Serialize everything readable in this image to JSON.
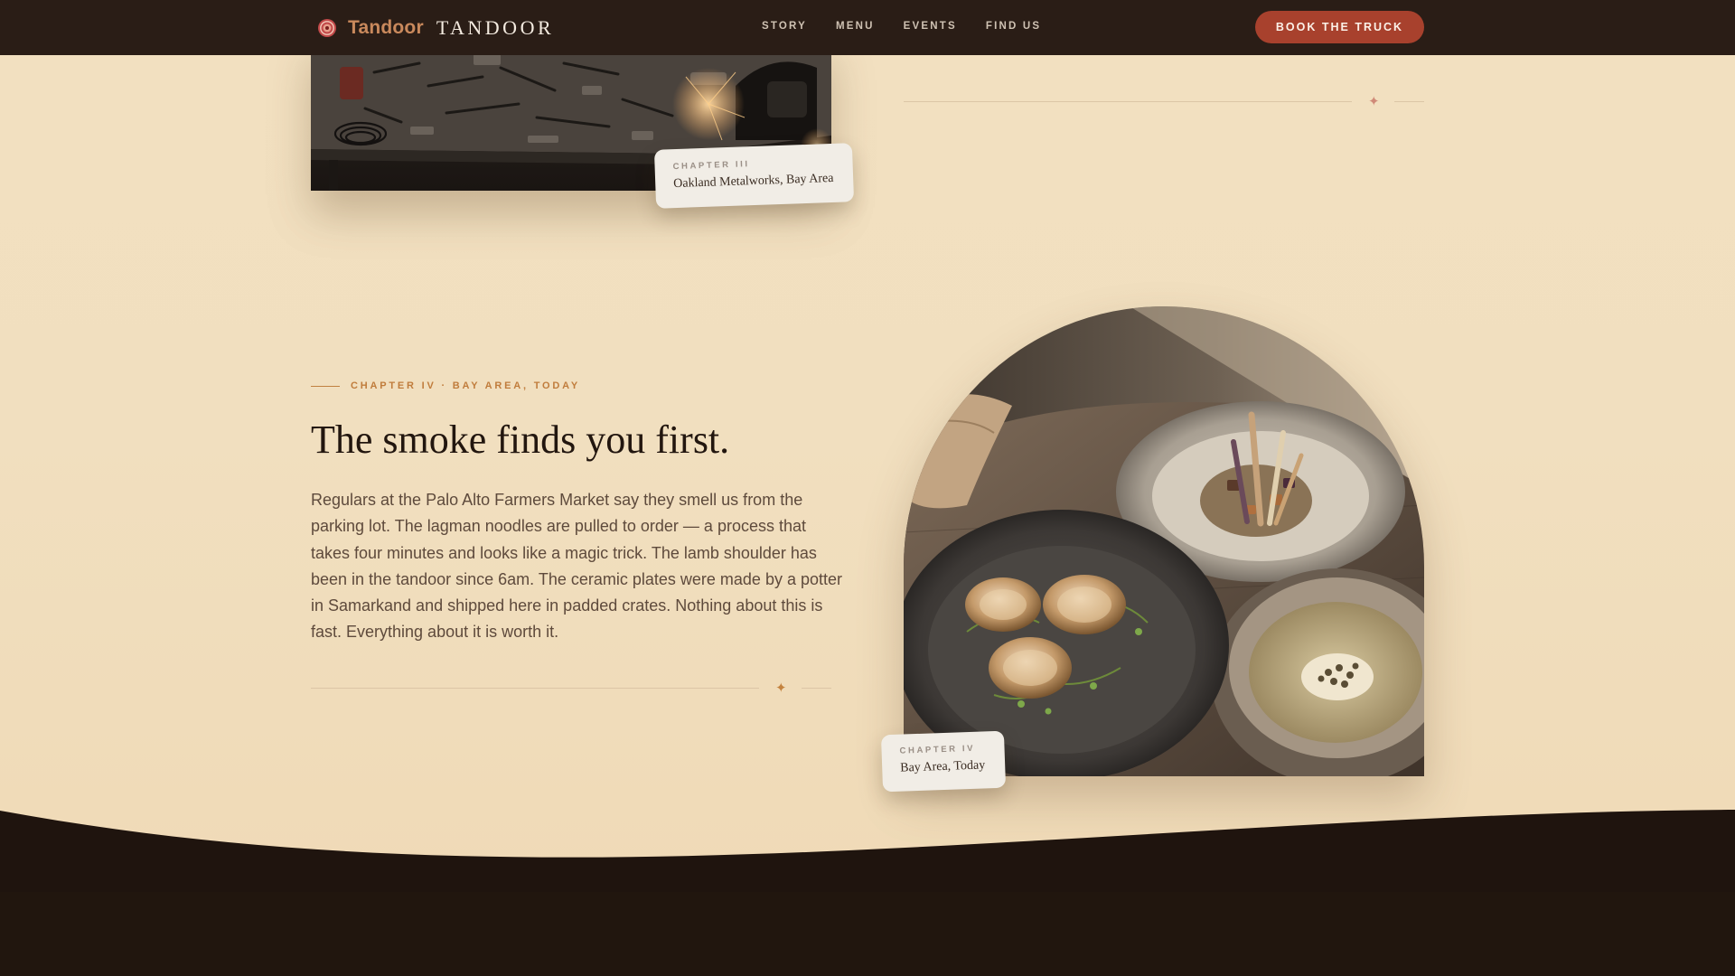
{
  "nav": {
    "brand_name": "Tandoor",
    "brand_word": "TANDOOR",
    "links": [
      "STORY",
      "MENU",
      "EVENTS",
      "FIND US"
    ],
    "cta": "BOOK THE TRUCK"
  },
  "chapter3": {
    "tag_label": "CHAPTER III",
    "tag_place": "Oakland Metalworks, Bay Area"
  },
  "chapter4": {
    "eyebrow": "CHAPTER IV · BAY AREA, TODAY",
    "headline": "The smoke finds you first.",
    "body": "Regulars at the Palo Alto Farmers Market say they smell us from the parking lot. The lagman noodles are pulled to order — a process that takes four minutes and looks like a magic trick. The lamb shoulder has been in the tandoor since 6am. The ceramic plates were made by a potter in Samarkand and shipped here in padded crates. Nothing about this is fast. Everything about it is worth it.",
    "tag_label": "CHAPTER IV",
    "tag_place": "Bay Area, Today"
  },
  "ornaments": {
    "star_glyph": "✦",
    "star_color_top": "#d08a78",
    "star_color_mid": "#c4833f"
  },
  "colors": {
    "nav_bg": "#2a1d16",
    "cta_bg": "#a8412d",
    "brand_accent": "#c9895c",
    "page_bg": "#f2e0c0",
    "footer_bg": "#1f140e"
  },
  "icons": {
    "brand": "flame-rosette-icon"
  }
}
